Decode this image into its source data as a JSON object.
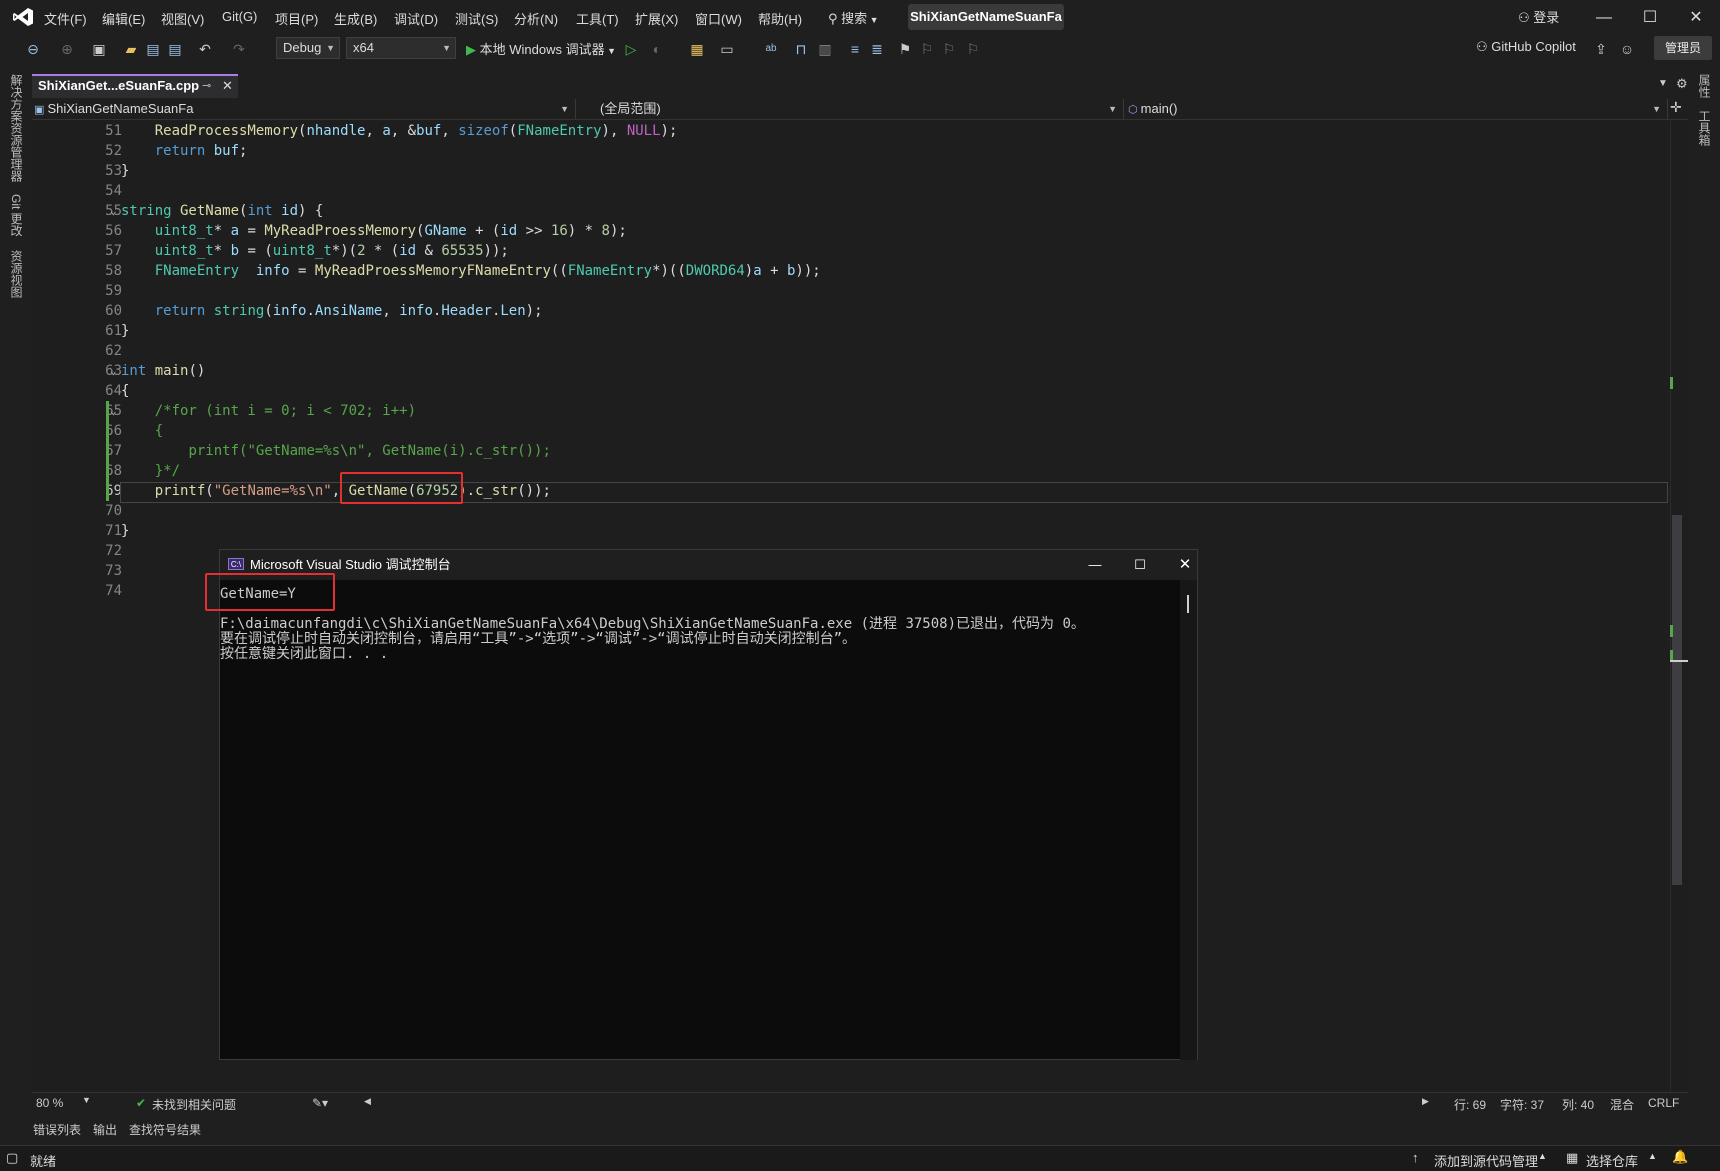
{
  "menubar": {
    "items": [
      "文件(F)",
      "编辑(E)",
      "视图(V)",
      "Git(G)",
      "项目(P)",
      "生成(B)",
      "调试(D)",
      "测试(S)",
      "分析(N)",
      "工具(T)",
      "扩展(X)",
      "窗口(W)",
      "帮助(H)"
    ],
    "search_label": "搜索",
    "solution_title": "ShiXianGetNameSuanFa",
    "login": "登录"
  },
  "toolbar": {
    "config": "Debug",
    "platform": "x64",
    "run_label": "本地 Windows 调试器",
    "copilot": "GitHub Copilot",
    "admin": "管理员"
  },
  "left_panel": {
    "solution_explorer": "解决方案资源管理器",
    "git_changes": "Git 更改",
    "resource_view": "资源视图"
  },
  "right_panel": {
    "properties": "属性",
    "toolbox": "工具箱"
  },
  "tab": {
    "filename": "ShiXianGet...eSuanFa.cpp"
  },
  "navbar": {
    "project": "ShiXianGetNameSuanFa",
    "scope": "(全局范围)",
    "member": "main()"
  },
  "code_lines": [
    {
      "n": "51",
      "tokens": [
        [
          "",
          "    "
        ],
        [
          "fn",
          "ReadProcessMemory"
        ],
        [
          "",
          "("
        ],
        [
          "var",
          "nhandle"
        ],
        [
          "",
          ", "
        ],
        [
          "var",
          "a"
        ],
        [
          "",
          ", &"
        ],
        [
          "var",
          "buf"
        ],
        [
          "",
          ", "
        ],
        [
          "kw",
          "sizeof"
        ],
        [
          "",
          "("
        ],
        [
          "ty",
          "FNameEntry"
        ],
        [
          "",
          "), "
        ],
        [
          "mac",
          "NULL"
        ],
        [
          "",
          ");"
        ]
      ]
    },
    {
      "n": "52",
      "tokens": [
        [
          "",
          "    "
        ],
        [
          "kw",
          "return"
        ],
        [
          "var",
          " buf"
        ],
        [
          "",
          ";"
        ]
      ]
    },
    {
      "n": "53",
      "tokens": [
        [
          "",
          "}"
        ]
      ]
    },
    {
      "n": "54",
      "tokens": []
    },
    {
      "n": "55",
      "tokens": [
        [
          "ty",
          "string"
        ],
        [
          "",
          ""
        ],
        [
          "fn",
          " GetName"
        ],
        [
          "",
          "("
        ],
        [
          "kw",
          "int"
        ],
        [
          "var",
          " id"
        ],
        [
          "",
          ") {"
        ]
      ]
    },
    {
      "n": "56",
      "tokens": [
        [
          "",
          "    "
        ],
        [
          "ty",
          "uint8_t"
        ],
        [
          "",
          "* "
        ],
        [
          "var",
          "a"
        ],
        [
          "",
          " = "
        ],
        [
          "fn",
          "MyReadProessMemory"
        ],
        [
          "",
          "("
        ],
        [
          "var",
          "GName"
        ],
        [
          "",
          " + ("
        ],
        [
          "var",
          "id"
        ],
        [
          "",
          " >> "
        ],
        [
          "num",
          "16"
        ],
        [
          "",
          ") * "
        ],
        [
          "num",
          "8"
        ],
        [
          "",
          ");"
        ]
      ]
    },
    {
      "n": "57",
      "tokens": [
        [
          "",
          "    "
        ],
        [
          "ty",
          "uint8_t"
        ],
        [
          "",
          "* "
        ],
        [
          "var",
          "b"
        ],
        [
          "",
          " = ("
        ],
        [
          "ty",
          "uint8_t"
        ],
        [
          "",
          "*)("
        ],
        [
          "num",
          "2"
        ],
        [
          "",
          " * ("
        ],
        [
          "var",
          "id"
        ],
        [
          "",
          " & "
        ],
        [
          "num",
          "65535"
        ],
        [
          "",
          "));"
        ]
      ]
    },
    {
      "n": "58",
      "tokens": [
        [
          "",
          "    "
        ],
        [
          "ty",
          "FNameEntry"
        ],
        [
          "",
          "  "
        ],
        [
          "var",
          "info"
        ],
        [
          "",
          " = "
        ],
        [
          "fn",
          "MyReadProessMemoryFNameEntry"
        ],
        [
          "",
          "(("
        ],
        [
          "ty",
          "FNameEntry"
        ],
        [
          "",
          "*)(("
        ],
        [
          "ty",
          "DWORD64"
        ],
        [
          "",
          ")"
        ],
        [
          "var",
          "a"
        ],
        [
          "",
          " + "
        ],
        [
          "var",
          "b"
        ],
        [
          "",
          "));"
        ]
      ]
    },
    {
      "n": "59",
      "tokens": []
    },
    {
      "n": "60",
      "tokens": [
        [
          "",
          "    "
        ],
        [
          "kw",
          "return"
        ],
        [
          "",
          " "
        ],
        [
          "ty",
          "string"
        ],
        [
          "",
          "("
        ],
        [
          "var",
          "info"
        ],
        [
          "",
          "."
        ],
        [
          "var",
          "AnsiName"
        ],
        [
          "",
          ", "
        ],
        [
          "var",
          "info"
        ],
        [
          "",
          "."
        ],
        [
          "var",
          "Header"
        ],
        [
          "",
          "."
        ],
        [
          "var",
          "Len"
        ],
        [
          "",
          ");"
        ]
      ]
    },
    {
      "n": "61",
      "tokens": [
        [
          "",
          "}"
        ]
      ]
    },
    {
      "n": "62",
      "tokens": []
    },
    {
      "n": "63",
      "tokens": [
        [
          "kw",
          "int"
        ],
        [
          "fn",
          " main"
        ],
        [
          "",
          "()"
        ]
      ]
    },
    {
      "n": "64",
      "tokens": [
        [
          "",
          "{"
        ]
      ]
    },
    {
      "n": "65",
      "tokens": [
        [
          "",
          "    "
        ],
        [
          "cm",
          "/*for (int i = 0; i < 702; i++)"
        ]
      ]
    },
    {
      "n": "66",
      "tokens": [
        [
          "",
          "    "
        ],
        [
          "cm",
          "{"
        ]
      ]
    },
    {
      "n": "67",
      "tokens": [
        [
          "",
          "        "
        ],
        [
          "cm",
          "printf(\"GetName=%s\\n\", GetName(i).c_str());"
        ]
      ]
    },
    {
      "n": "68",
      "tokens": [
        [
          "",
          "    "
        ],
        [
          "cm",
          "}*/"
        ]
      ]
    },
    {
      "n": "69",
      "tokens": [
        [
          "",
          "    "
        ],
        [
          "fn",
          "printf"
        ],
        [
          "",
          "("
        ],
        [
          "str",
          "\"GetName=%s\\n\""
        ],
        [
          "",
          ", "
        ],
        [
          "fn",
          "GetName"
        ],
        [
          "",
          "("
        ],
        [
          "num",
          "67952"
        ],
        [
          "",
          ")."
        ],
        [
          "fn",
          "c_str"
        ],
        [
          "",
          "());"
        ]
      ]
    },
    {
      "n": "70",
      "tokens": []
    },
    {
      "n": "71",
      "tokens": [
        [
          "",
          "}"
        ]
      ]
    },
    {
      "n": "72",
      "tokens": []
    },
    {
      "n": "73",
      "tokens": []
    },
    {
      "n": "74",
      "tokens": []
    }
  ],
  "editor_status": {
    "zoom": "80 %",
    "issues": "未找到相关问题",
    "line": "行: 69",
    "char": "字符: 37",
    "col": "列: 40",
    "mixed": "混合",
    "eol": "CRLF"
  },
  "bottom_tabs": [
    "错误列表",
    "输出",
    "查找符号结果"
  ],
  "status": {
    "ready": "就绪",
    "add_source": "添加到源代码管理",
    "select_repo": "选择仓库"
  },
  "console": {
    "title": "Microsoft Visual Studio 调试控制台",
    "lines": [
      "GetName=Y",
      "",
      "F:\\daimacunfangdi\\c\\ShiXianGetNameSuanFa\\x64\\Debug\\ShiXianGetNameSuanFa.exe (进程 37508)已退出，代码为 0。",
      "要在调试停止时自动关闭控制台，请启用“工具”->“选项”->“调试”->“调试停止时自动关闭控制台”。",
      "按任意键关闭此窗口. . ."
    ]
  }
}
